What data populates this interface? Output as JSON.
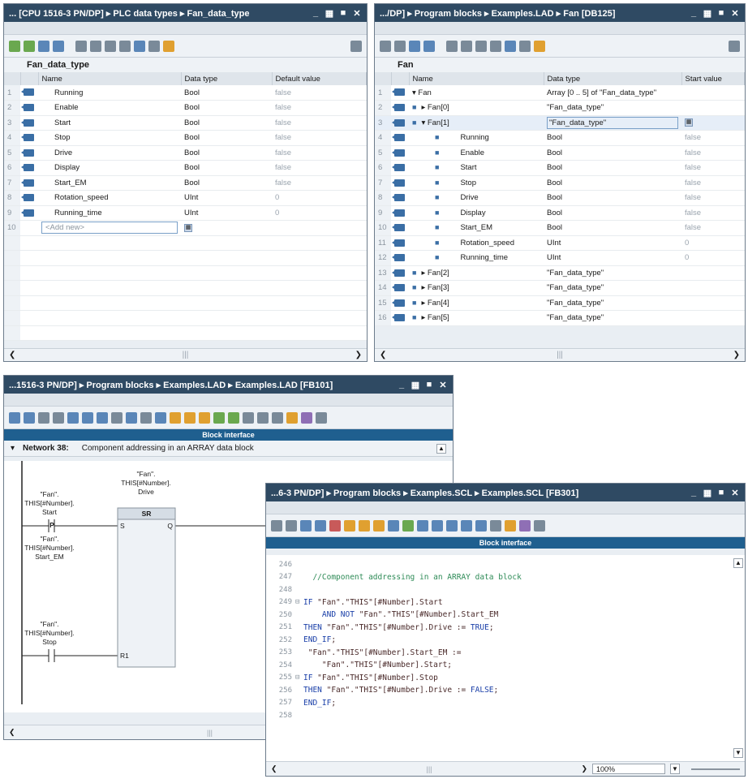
{
  "win1": {
    "title": "... [CPU 1516-3 PN/DP] ▸ PLC data types ▸ Fan_data_type",
    "block_name": "Fan_data_type",
    "columns": [
      "Name",
      "Data type",
      "Default value"
    ],
    "rows": [
      {
        "num": "1",
        "name": "Running",
        "type": "Bool",
        "value": "false"
      },
      {
        "num": "2",
        "name": "Enable",
        "type": "Bool",
        "value": "false"
      },
      {
        "num": "3",
        "name": "Start",
        "type": "Bool",
        "value": "false"
      },
      {
        "num": "4",
        "name": "Stop",
        "type": "Bool",
        "value": "false"
      },
      {
        "num": "5",
        "name": "Drive",
        "type": "Bool",
        "value": "false"
      },
      {
        "num": "6",
        "name": "Display",
        "type": "Bool",
        "value": "false"
      },
      {
        "num": "7",
        "name": "Start_EM",
        "type": "Bool",
        "value": "false"
      },
      {
        "num": "8",
        "name": "Rotation_speed",
        "type": "UInt",
        "value": "0"
      },
      {
        "num": "9",
        "name": "Running_time",
        "type": "UInt",
        "value": "0"
      }
    ],
    "add_new_num": "10",
    "add_new": "<Add new>"
  },
  "win2": {
    "title": ".../DP] ▸ Program blocks ▸ Examples.LAD ▸ Fan [DB125]",
    "block_name": "Fan",
    "columns": [
      "Name",
      "Data type",
      "Start value"
    ],
    "rows": [
      {
        "num": "1",
        "name": "▾ Fan",
        "type": "Array [0 .. 5] of \"Fan_data_type\"",
        "value": ""
      },
      {
        "num": "2",
        "name": "▸ Fan[0]",
        "type": "\"Fan_data_type\"",
        "value": ""
      },
      {
        "num": "3",
        "name": "▾ Fan[1]",
        "type": "\"Fan_data_type\"",
        "value": ""
      },
      {
        "num": "4",
        "name": "Running",
        "type": "Bool",
        "value": "false"
      },
      {
        "num": "5",
        "name": "Enable",
        "type": "Bool",
        "value": "false"
      },
      {
        "num": "6",
        "name": "Start",
        "type": "Bool",
        "value": "false"
      },
      {
        "num": "7",
        "name": "Stop",
        "type": "Bool",
        "value": "false"
      },
      {
        "num": "8",
        "name": "Drive",
        "type": "Bool",
        "value": "false"
      },
      {
        "num": "9",
        "name": "Display",
        "type": "Bool",
        "value": "false"
      },
      {
        "num": "10",
        "name": "Start_EM",
        "type": "Bool",
        "value": "false"
      },
      {
        "num": "11",
        "name": "Rotation_speed",
        "type": "UInt",
        "value": "0"
      },
      {
        "num": "12",
        "name": "Running_time",
        "type": "UInt",
        "value": "0"
      },
      {
        "num": "13",
        "name": "▸ Fan[2]",
        "type": "\"Fan_data_type\"",
        "value": ""
      },
      {
        "num": "14",
        "name": "▸ Fan[3]",
        "type": "\"Fan_data_type\"",
        "value": ""
      },
      {
        "num": "15",
        "name": "▸ Fan[4]",
        "type": "\"Fan_data_type\"",
        "value": ""
      },
      {
        "num": "16",
        "name": "▸ Fan[5]",
        "type": "\"Fan_data_type\"",
        "value": ""
      }
    ]
  },
  "win3": {
    "title": "...1516-3 PN/DP] ▸ Program blocks ▸ Examples.LAD ▸ Examples.LAD [FB101]",
    "block_interface": "Block interface",
    "network_label": "Network 38:",
    "network_comment": "Component addressing in an ARRAY data block",
    "coil": {
      "l1": "\"Fan\".",
      "l2": "THIS[#Number].",
      "l3": "Drive"
    },
    "start": {
      "l1": "\"Fan\".",
      "l2": "THIS[#Number].",
      "l3": "Start"
    },
    "start_em": {
      "l1": "\"Fan\".",
      "l2": "THIS[#Number].",
      "l3": "Start_EM"
    },
    "stop": {
      "l1": "\"Fan\".",
      "l2": "THIS[#Number].",
      "l3": "Stop"
    },
    "box_title": "SR",
    "pin_s": "S",
    "pin_q": "Q",
    "pin_r1": "R1",
    "contact_p": "P",
    "zoom_partial": "100"
  },
  "win4": {
    "title": "...6-3 PN/DP] ▸ Program blocks ▸ Examples.SCL ▸ Examples.SCL [FB301]",
    "block_interface": "Block interface",
    "lines": [
      {
        "n": "246",
        "t": ""
      },
      {
        "n": "247",
        "t": "  //Component addressing in an ARRAY data block"
      },
      {
        "n": "248",
        "t": ""
      },
      {
        "n": "249",
        "t": "IF \"Fan\".\"THIS\"[#Number].Start"
      },
      {
        "n": "250",
        "t": "    AND NOT \"Fan\".\"THIS\"[#Number].Start_EM"
      },
      {
        "n": "251",
        "t": "THEN \"Fan\".\"THIS\"[#Number].Drive := TRUE;"
      },
      {
        "n": "252",
        "t": "END_IF;"
      },
      {
        "n": "253",
        "t": " \"Fan\".\"THIS\"[#Number].Start_EM :="
      },
      {
        "n": "254",
        "t": "    \"Fan\".\"THIS\"[#Number].Start;"
      },
      {
        "n": "255",
        "t": "IF \"Fan\".\"THIS\"[#Number].Stop"
      },
      {
        "n": "256",
        "t": "THEN \"Fan\".\"THIS\"[#Number].Drive := FALSE;"
      },
      {
        "n": "257",
        "t": "END_IF;"
      },
      {
        "n": "258",
        "t": ""
      }
    ],
    "zoom": "100%"
  }
}
